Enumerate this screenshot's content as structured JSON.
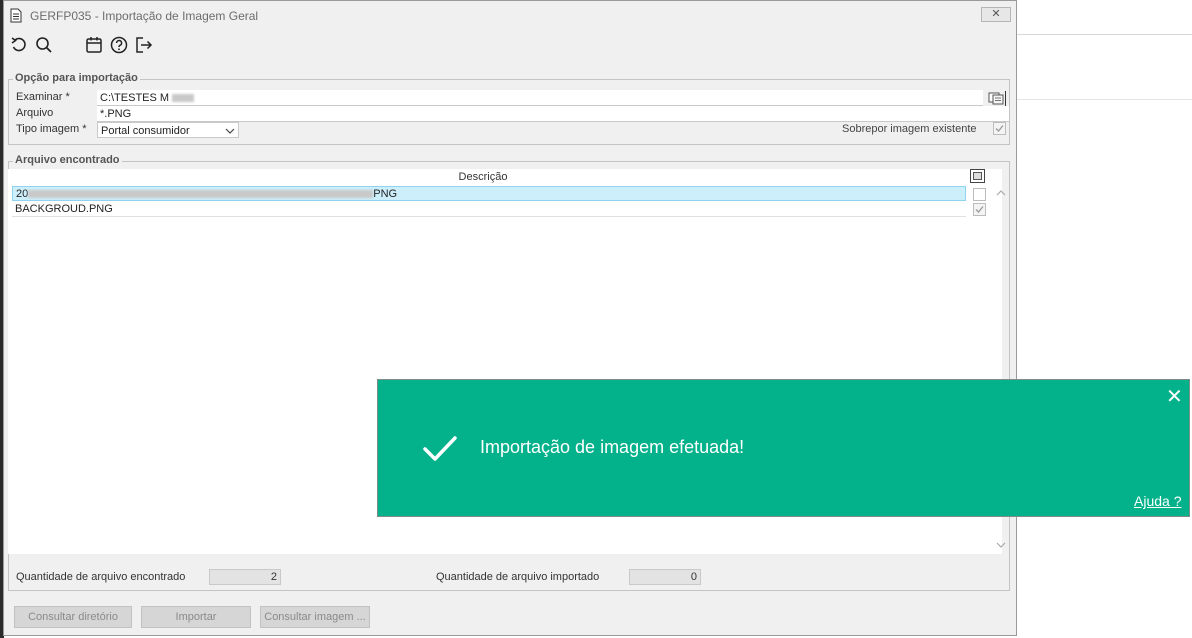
{
  "window": {
    "title": "GERFP035 - Importação de Imagem Geral",
    "close_label": "✕"
  },
  "toolbar": {
    "icons": [
      "undo-icon",
      "search-icon",
      "calendar-icon",
      "help-icon",
      "exit-icon"
    ]
  },
  "options": {
    "legend": "Opção para importação",
    "examinar_label": "Examinar *",
    "examinar_value": "C:\\TESTES M",
    "arquivo_label": "Arquivo",
    "arquivo_value": "*.PNG",
    "tipo_label": "Tipo imagem *",
    "tipo_value": "Portal consumidor",
    "sobrepor_label": "Sobrepor imagem existente",
    "sobrepor_checked": true
  },
  "files": {
    "legend": "Arquivo encontrado",
    "column_header": "Descrição",
    "rows": [
      {
        "prefix": "20",
        "suffix": "PNG",
        "checked": false,
        "selected": true
      },
      {
        "prefix": "BACKGROUD.PNG",
        "suffix": "",
        "checked": true,
        "selected": false
      }
    ]
  },
  "summary": {
    "found_label": "Quantidade de arquivo encontrado",
    "found_value": "2",
    "imported_label": "Quantidade de arquivo importado",
    "imported_value": "0"
  },
  "buttons": {
    "consultar_diretorio": "Consultar diretório",
    "importar": "Importar",
    "consultar_imagem": "Consultar imagem ..."
  },
  "toast": {
    "message": "Importação de imagem efetuada!",
    "help_link": "Ajuda ?",
    "close": "✕",
    "color": "#03b18b"
  }
}
